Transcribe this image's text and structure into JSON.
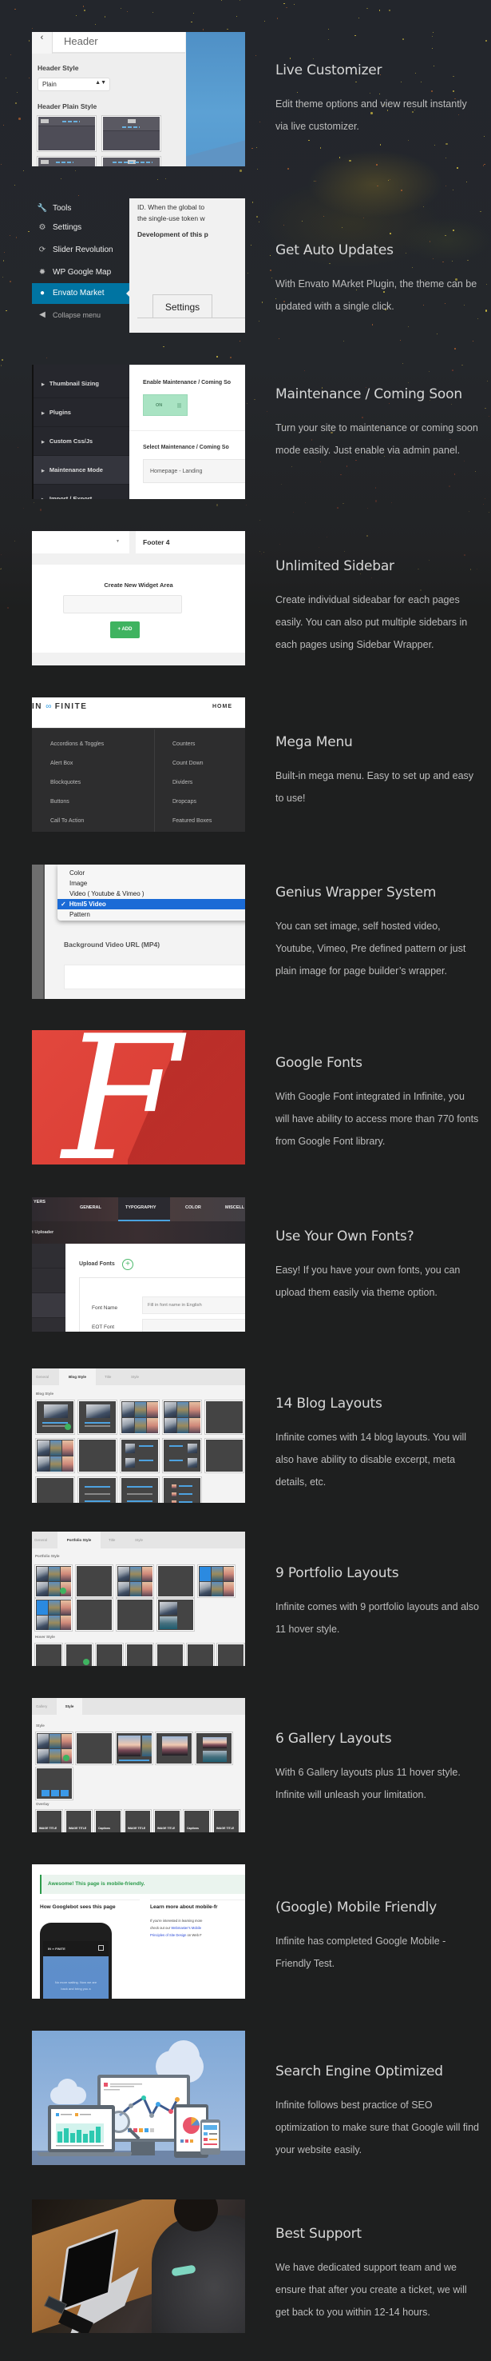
{
  "features": [
    {
      "title": "Live Customizer",
      "description": "Edit theme options and view result instantly via live customizer.",
      "screenshot": {
        "back_icon": "chevron-left-icon",
        "panel_title": "Header",
        "header_style_label": "Header Style",
        "header_style_value": "Plain",
        "header_plain_style_label": "Header Plain Style"
      }
    },
    {
      "title": "Get Auto Updates",
      "description": "With Envato MArket Plugin, the theme can be updated with a single click.",
      "screenshot": {
        "menu": [
          {
            "label": "Tools",
            "icon": "wrench-icon",
            "glyph": "🔧"
          },
          {
            "label": "Settings",
            "icon": "settings-icon",
            "glyph": "⚙"
          },
          {
            "label": "Slider Revolution",
            "icon": "refresh-icon",
            "glyph": "⟳"
          },
          {
            "label": "WP Google Map",
            "icon": "gear-icon",
            "glyph": "✹"
          },
          {
            "label": "Envato Market",
            "icon": "leaf-icon",
            "glyph": "●",
            "active": true
          },
          {
            "label": "Collapse menu",
            "icon": "collapse-icon",
            "glyph": "◀"
          }
        ],
        "panel_line_1": "ID. When the global to",
        "panel_line_2": "the single-use token w",
        "panel_line_3": "Development of this p",
        "tab_label": "Settings"
      }
    },
    {
      "title": "Maintenance / Coming Soon",
      "description": "Turn your site to maintenance or coming soon mode easily. Just enable via admin panel.",
      "screenshot": {
        "sidebar": [
          "Thumbnail Sizing",
          "Plugins",
          "Custom Css/Js",
          "Maintenance Mode",
          "Import / Export"
        ],
        "active_index": 3,
        "enable_label": "Enable Maintenance / Coming So",
        "toggle_value": "ON",
        "select_label": "Select Maintenance / Coming So",
        "select_value": "Homepage - Landing"
      }
    },
    {
      "title": "Unlimited Sidebar",
      "description": "Create individual sideabar for each pages easily. You can also put multiple sidebars in each pages using Sidebar Wrapper.",
      "screenshot": {
        "footer_label": "Footer 4",
        "card_title": "Create New Widget Area",
        "input_value": "",
        "add_button": "+ ADD"
      }
    },
    {
      "title": "Mega Menu",
      "description": "Built-in mega menu. Easy to set up and easy to use!",
      "screenshot": {
        "logo_left": "IN",
        "logo_symbol": "∞",
        "logo_right": "FINITE",
        "nav_item": "HOME",
        "column_1": [
          "Accordions & Toggles",
          "Alert Box",
          "Blockquotes",
          "Buttons",
          "Call To Action"
        ],
        "column_2": [
          "Counters",
          "Count Down",
          "Dividers",
          "Dropcaps",
          "Featured Boxes"
        ]
      }
    },
    {
      "title": "Genius Wrapper System",
      "description": "You can set image, self hosted video, Youtube, Vimeo, Pre defined pattern or just plain image for page builder’s wrapper.",
      "screenshot": {
        "options": [
          "Color",
          "Image",
          "Video ( Youtube & Vimeo )",
          "Html5 Video",
          "Pattern"
        ],
        "selected_index": 3,
        "check_mark": "✓",
        "field_label": "Background Video URL (MP4)",
        "field_value": ""
      }
    },
    {
      "title": "Google Fonts",
      "description": "With Google Font integrated in Infinite, you will have ability to access more than 770 fonts from Google Font library.",
      "screenshot": {
        "glyph": "F"
      }
    },
    {
      "title": "Use Your Own Fonts?",
      "description": "Easy! If you have your own fonts, you can upload them easily via theme option.",
      "screenshot": {
        "left_tab_partial": "YERS",
        "tabs": [
          "GENERAL",
          "TYPOGRAPHY",
          "COLOR",
          "MISCELL"
        ],
        "active_tab": 1,
        "section_label": "t Uploader",
        "upload_title": "Upload Fonts",
        "plus_icon": "+",
        "font_name_label": "Font Name",
        "font_name_placeholder": "Fill in font name in English",
        "eot_label": "EOT Font"
      }
    },
    {
      "title": "14 Blog Layouts",
      "description": "Infinite comes with 14 blog layouts. You will also have ability to disable excerpt, meta details, etc.",
      "screenshot": {
        "tabs": [
          "General",
          "Blog Style",
          "Title",
          "Style"
        ],
        "active_tab": 1,
        "section_label": "Blog Style",
        "layout_count": 14
      }
    },
    {
      "title": "9 Portfolio Layouts",
      "description": "Infinite comes with 9 portfolio layouts and also 11 hover style.",
      "screenshot": {
        "tabs": [
          "General",
          "Portfolio Style",
          "Title",
          "Style"
        ],
        "active_tab": 1,
        "section_label": "Portfolio Style",
        "hover_label": "Hover Style",
        "layout_count": 9
      }
    },
    {
      "title": "6 Gallery Layouts",
      "description": "With 6 Gallery layouts plus  11 hover style. Infinite will unleash your limitation.",
      "screenshot": {
        "tabs": [
          "Gallery",
          "Style"
        ],
        "active_tab": 1,
        "section_label": "Style",
        "overlay_label": "Overlay",
        "overlay_texts": [
          "IMAGE TITLE",
          "IMAGE TITLE",
          "Captions",
          "IMAGE TITLE",
          "IMAGE TITLE",
          "Captions",
          "IMAGE TITLE"
        ]
      }
    },
    {
      "title": "(Google) Mobile Friendly",
      "description": "Infinite has completed Google Mobile - Friendly Test.",
      "screenshot": {
        "alert": "Awesome! This page is mobile-friendly.",
        "left_heading": "How Googlebot sees this page",
        "right_heading": "Learn more about mobile-fr",
        "right_p1": "If you're interested in learning more",
        "right_p2_prefix": "check out our ",
        "right_p2_link": "Webmaster's Mobile",
        "right_p3_link": "Principles of Site Design",
        "right_p3_suffix": " on Web F",
        "phone_logo": "IN ∞ FINITE",
        "phone_line_1": "No more waiting. Now we are",
        "phone_line_2": "back and bring you a"
      }
    },
    {
      "title": "Search Engine Optimized",
      "description": "Infinite follows best practice of SEO optimization to make sure that Google will find your website easily.",
      "screenshot": {}
    },
    {
      "title": "Best Support",
      "description": "We have dedicated support team and we ensure that after you create a ticket, we will get back to you within 12-14 hours.",
      "screenshot": {}
    }
  ],
  "colors": {
    "page_bg": "#1e1f1f",
    "title": "#e6e6e6",
    "desc": "#bdbdbd",
    "wp_active": "#0074a2",
    "add_green": "#3fb360",
    "google_red": "#e2473d",
    "select_blue": "#1b6bd6"
  }
}
